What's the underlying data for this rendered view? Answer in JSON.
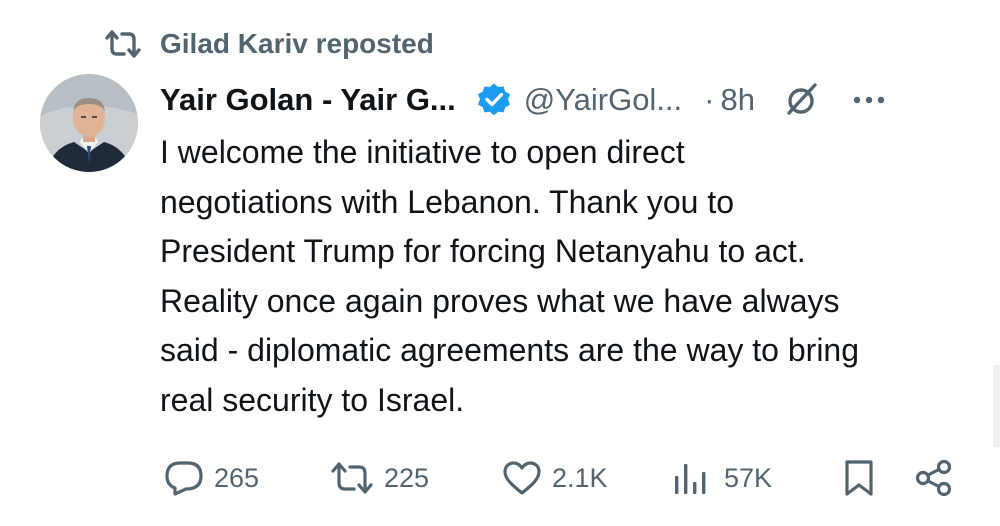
{
  "repost": {
    "label": "Gilad Kariv reposted",
    "icon": "repost-icon"
  },
  "author": {
    "display_name": "Yair Golan - Yair G...",
    "handle": "@YairGol...",
    "separator": "·",
    "time": "8h",
    "verified_color": "#1d9bf0"
  },
  "tweet": {
    "lines": [
      "I welcome the initiative to open direct",
      "negotiations with Lebanon. Thank you to",
      "President Trump for forcing Netanyahu to act.",
      "Reality once again proves what we have always",
      "said - diplomatic agreements are the way to bring",
      "real security to Israel."
    ]
  },
  "actions": {
    "replies": "265",
    "reposts": "225",
    "likes": "2.1K",
    "views": "57K"
  },
  "colors": {
    "text_primary": "#0f1419",
    "text_secondary": "#536471",
    "accent": "#1d9bf0"
  }
}
